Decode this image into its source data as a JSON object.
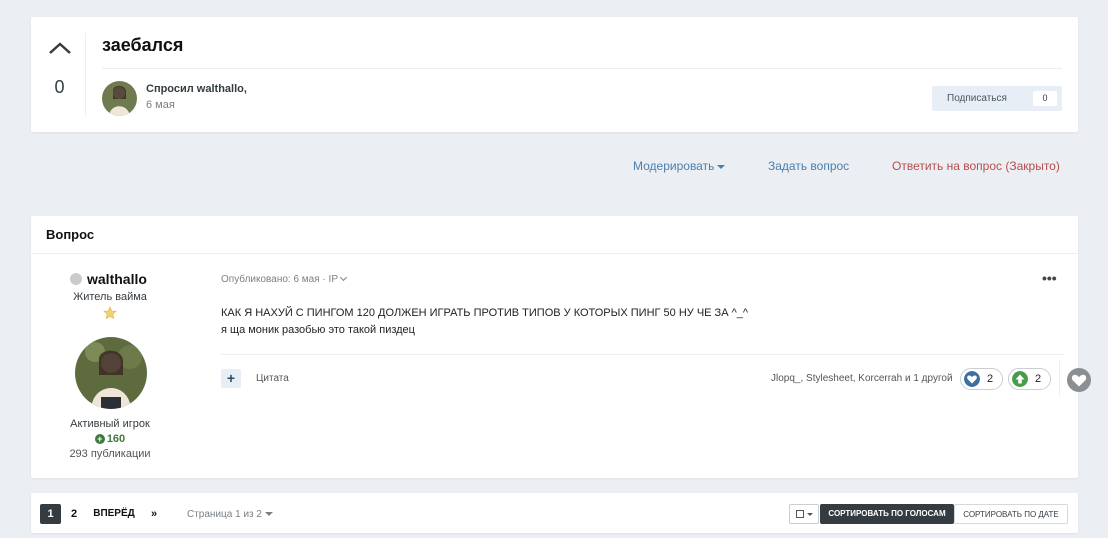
{
  "header": {
    "vote_count": "0",
    "title": "заебался",
    "asked_by": "Спросил walthallo,",
    "date": "6 мая",
    "follow_label": "Подписаться",
    "follow_count": "0"
  },
  "actions": {
    "moderate": "Модерировать",
    "ask": "Задать вопрос",
    "reply": "Ответить на вопрос (Закрыто)"
  },
  "question": {
    "header_title": "Вопрос",
    "author": {
      "name": "walthallo",
      "rank": "Житель вайма",
      "status": "Активный игрок",
      "reputation": "160",
      "posts": "293 публикации"
    },
    "meta": "Опубликовано: 6 мая · IP",
    "more": "•••",
    "body_line1": "КАК Я НАХУЙ С ПИНГОМ 120 ДОЛЖЕН ИГРАТЬ ПРОТИВ ТИПОВ У КОТОРЫХ ПИНГ 50 НУ ЧЕ ЗА ^_^",
    "body_line2": "я ща моник разобью это такой пиздец",
    "plus": "+",
    "quote": "Цитата",
    "reactors": "Jlopq_, Stylesheet, Korcerrah и 1 другой",
    "reactions": [
      {
        "icon": "heart-reaction-icon",
        "count": "2",
        "color": "#3e6fa3"
      },
      {
        "icon": "upvote-reaction-icon",
        "count": "2",
        "color": "#4a9b4a"
      }
    ]
  },
  "pagination": {
    "pages": [
      "1",
      "2"
    ],
    "next": "ВПЕРЁД",
    "last": "»",
    "info": "Страница 1 из 2",
    "sort_votes": "СОРТИРОВАТЬ ПО ГОЛОСАМ",
    "sort_date": "СОРТИРОВАТЬ ПО ДАТЕ"
  },
  "colors": {
    "background": "#ebeef2",
    "link": "#4a80ad",
    "danger_link": "#b84c4c",
    "dark_button": "#353c41"
  }
}
